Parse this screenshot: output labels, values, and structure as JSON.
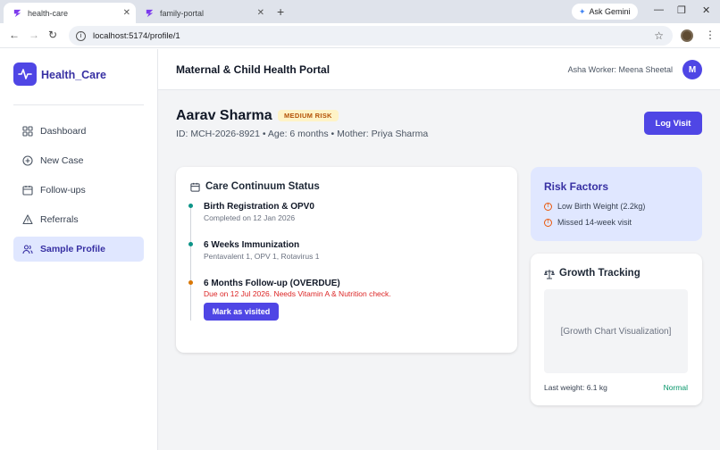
{
  "browser": {
    "tabs": [
      {
        "label": "health-care",
        "active": true
      },
      {
        "label": "family-portal",
        "active": false
      }
    ],
    "gemini_label": "Ask Gemini",
    "url": "localhost:5174/profile/1"
  },
  "sidebar": {
    "brand": "Health_Care",
    "items": [
      {
        "label": "Dashboard",
        "icon": "grid-icon"
      },
      {
        "label": "New Case",
        "icon": "plus-circle-icon"
      },
      {
        "label": "Follow-ups",
        "icon": "calendar-icon"
      },
      {
        "label": "Referrals",
        "icon": "alert-triangle-icon"
      },
      {
        "label": "Sample Profile",
        "icon": "users-icon",
        "active": true
      }
    ]
  },
  "header": {
    "title": "Maternal & Child Health Portal",
    "worker": "Asha Worker: Meena Sheetal",
    "avatar_initial": "M"
  },
  "patient": {
    "name": "Aarav Sharma",
    "risk_badge": "MEDIUM RISK",
    "meta": "ID: MCH-2026-8921 • Age: 6 months • Mother: Priya Sharma",
    "log_visit_label": "Log Visit"
  },
  "care": {
    "title": "Care Continuum Status",
    "events": [
      {
        "title": "Birth Registration & OPV0",
        "sub": "Completed on 12 Jan 2026",
        "status": "done"
      },
      {
        "title": "6 Weeks Immunization",
        "sub": "Pentavalent 1, OPV 1, Rotavirus 1",
        "status": "done"
      },
      {
        "title": "6 Months Follow-up (OVERDUE)",
        "sub": "Due on 12 Jul 2026. Needs Vitamin A & Nutrition check.",
        "status": "overdue"
      }
    ],
    "mark_visited_label": "Mark as visited"
  },
  "risk_factors": {
    "title": "Risk Factors",
    "items": [
      "Low Birth Weight (2.2kg)",
      "Missed 14-week visit"
    ]
  },
  "growth": {
    "title": "Growth Tracking",
    "placeholder": "[Growth Chart Visualization]",
    "last_weight": "Last weight: 6.1 kg",
    "status": "Normal"
  },
  "colors": {
    "accent": "#4f46e5",
    "done": "#0d9488",
    "overdue": "#d97706",
    "danger": "#dc2626",
    "normal": "#059669"
  }
}
